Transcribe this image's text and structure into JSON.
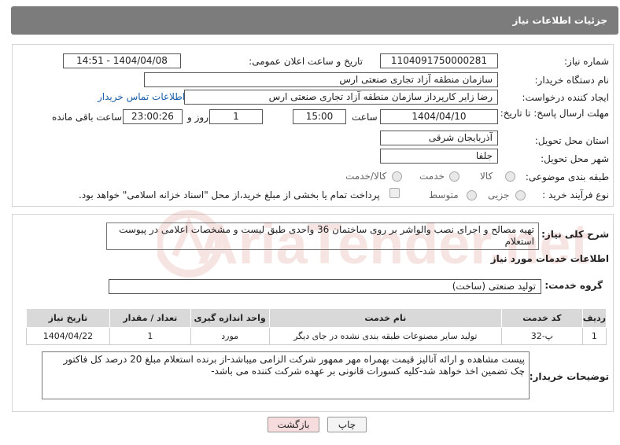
{
  "header": {
    "title": "جزئیات اطلاعات نیاز"
  },
  "form": {
    "need_number_label": "شماره نیاز:",
    "need_number": "1104091750000281",
    "announce_label": "تاریخ و ساعت اعلان عمومی:",
    "announce_value": "1404/04/08 - 14:51",
    "buyer_org_label": "نام دستگاه خریدار:",
    "buyer_org": "سازمان منطقه آزاد تجاری صنعتی ارس",
    "creator_label": "ایجاد کننده درخواست:",
    "creator": "رضا زاير كارپرداز سازمان منطقه آزاد تجاری صنعتی ارس",
    "contact_link": "اطلاعات تماس خریدار",
    "deadline_label": "مهلت ارسال پاسخ: تا تاریخ:",
    "deadline_date": "1404/04/10",
    "time_label": "ساعت",
    "deadline_time": "15:00",
    "days_value": "1",
    "days_label": "روز و",
    "remaining_time": "23:00:26",
    "remaining_label": "ساعت باقی مانده",
    "province_label": "استان محل تحویل:",
    "province": "آذربایجان شرقی",
    "city_label": "شهر محل تحویل:",
    "city": "جلفا",
    "category_label": "طبقه بندی موضوعی:",
    "category_options": [
      "کالا",
      "خدمت",
      "کالا/خدمت"
    ],
    "process_label": "نوع فرآیند خرید :",
    "process_options": [
      "جزیی",
      "متوسط"
    ],
    "payment_note": "پرداخت تمام یا بخشی از مبلغ خرید،از محل \"اسناد خزانه اسلامی\" خواهد بود."
  },
  "summary": {
    "label": "شرح کلی نیاز:",
    "text": "تهیه مصالح و اجرای نصب والواشر بر روی ساختمان 36 واحدی طبق لیست و مشخصات اعلامی در پیوست استعلام"
  },
  "services": {
    "title": "اطلاعات خدمات مورد نیاز",
    "group_label": "گروه خدمت:",
    "group_value": "تولید صنعتی (ساخت)",
    "columns": [
      "ردیف",
      "کد خدمت",
      "نام خدمت",
      "واحد اندازه گیری",
      "تعداد / مقدار",
      "تاریخ نیاز"
    ],
    "rows": [
      [
        "1",
        "پ-32",
        "تولید سایر مصنوعات طبقه بندی نشده در جای دیگر",
        "مورد",
        "1",
        "1404/04/22"
      ]
    ]
  },
  "notes": {
    "label": "توضیحات خریدار:",
    "text": "پیست مشاهده و ارائه آنالیز قیمت بهمراه مهر ممهور شرکت الزامی میباشد-از برنده استعلام مبلغ 20 درصد کل فاکتور چک تضمین اخذ خواهد شد-کلیه کسورات قانونی  بر عهده شرکت کننده می باشد-"
  },
  "buttons": {
    "print": "چاپ",
    "back": "بازگشت"
  },
  "watermark": {
    "text": "AriaTender.net"
  },
  "colors": {
    "header_bg": "#7c7c7c",
    "link": "#1a5ea8",
    "back_bg": "#f6dcdc",
    "table_header": "#d9d9d9",
    "watermark": "#c0392b"
  }
}
